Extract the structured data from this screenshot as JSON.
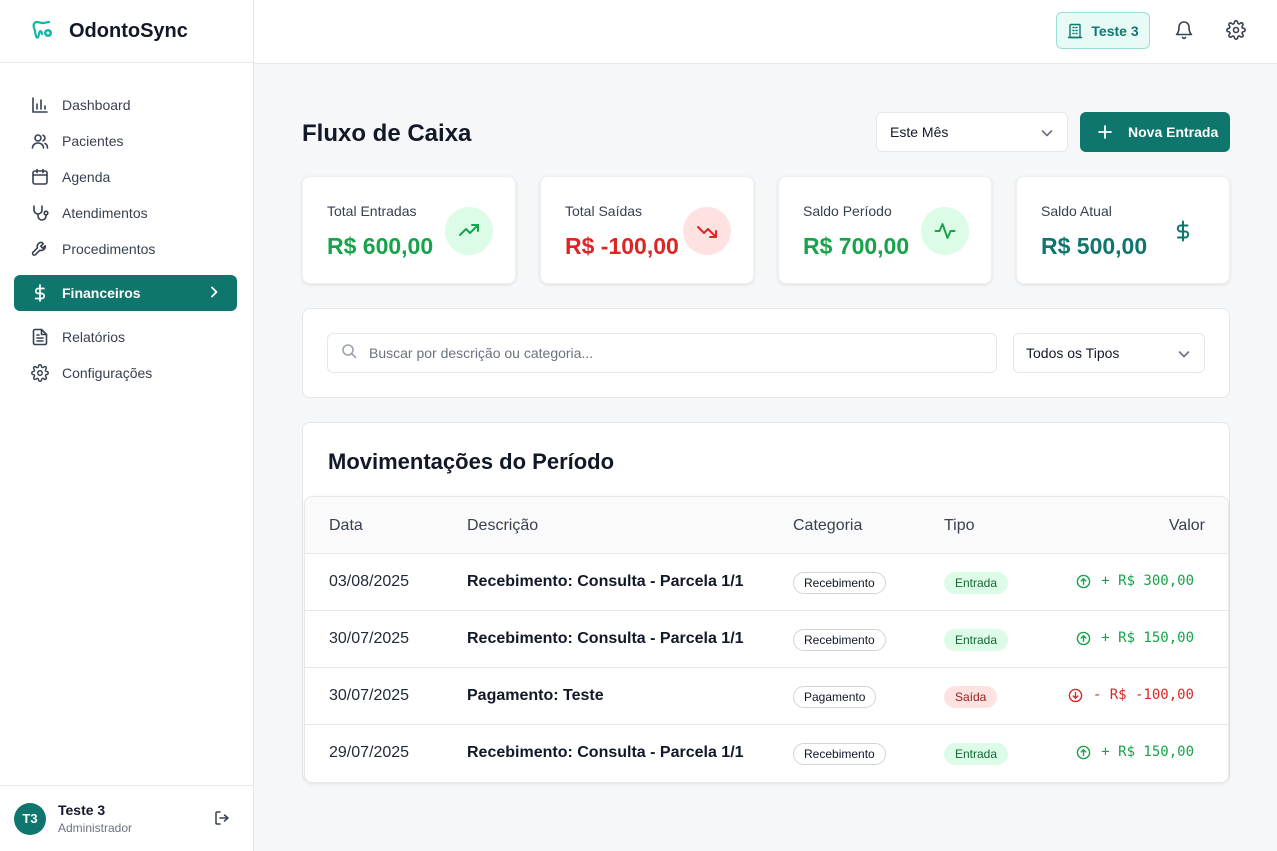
{
  "app": {
    "name": "OdontoSync"
  },
  "colors": {
    "brand": "#0f766e",
    "positive": "#16a34a",
    "negative": "#dc2626"
  },
  "sidebar": {
    "items": [
      {
        "label": "Dashboard",
        "icon": "bar-chart-icon"
      },
      {
        "label": "Pacientes",
        "icon": "users-icon"
      },
      {
        "label": "Agenda",
        "icon": "calendar-icon"
      },
      {
        "label": "Atendimentos",
        "icon": "stethoscope-icon"
      },
      {
        "label": "Procedimentos",
        "icon": "wrench-icon"
      },
      {
        "label": "Financeiros",
        "icon": "dollar-icon",
        "active": true
      },
      {
        "label": "Relatórios",
        "icon": "file-text-icon"
      },
      {
        "label": "Configurações",
        "icon": "gear-icon"
      }
    ]
  },
  "user": {
    "initials": "T3",
    "name": "Teste 3",
    "role": "Administrador"
  },
  "topbar": {
    "clinic": "Teste 3"
  },
  "header": {
    "title": "Fluxo de Caixa",
    "period": "Este Mês",
    "new_button": "Nova Entrada"
  },
  "cards": [
    {
      "label": "Total Entradas",
      "value": "R$ 600,00",
      "icon": "trending-up-icon"
    },
    {
      "label": "Total Saídas",
      "value": "R$ -100,00",
      "icon": "trending-down-icon"
    },
    {
      "label": "Saldo Período",
      "value": "R$ 700,00",
      "icon": "activity-icon"
    },
    {
      "label": "Saldo Atual",
      "value": "R$ 500,00",
      "icon": "dollar-icon"
    }
  ],
  "filters": {
    "search_placeholder": "Buscar por descrição ou categoria...",
    "type": "Todos os Tipos"
  },
  "table": {
    "title": "Movimentações do Período",
    "columns": [
      "Data",
      "Descrição",
      "Categoria",
      "Tipo",
      "Valor"
    ],
    "rows": [
      {
        "data": "03/08/2025",
        "descricao": "Recebimento: Consulta - Parcela 1/1",
        "categoria": "Recebimento",
        "tipo": "Entrada",
        "valor": "+ R$ 300,00"
      },
      {
        "data": "30/07/2025",
        "descricao": "Recebimento: Consulta - Parcela 1/1",
        "categoria": "Recebimento",
        "tipo": "Entrada",
        "valor": "+ R$ 150,00"
      },
      {
        "data": "30/07/2025",
        "descricao": "Pagamento: Teste",
        "categoria": "Pagamento",
        "tipo": "Saída",
        "valor": "- R$ -100,00"
      },
      {
        "data": "29/07/2025",
        "descricao": "Recebimento: Consulta - Parcela 1/1",
        "categoria": "Recebimento",
        "tipo": "Entrada",
        "valor": "+ R$ 150,00"
      }
    ]
  }
}
